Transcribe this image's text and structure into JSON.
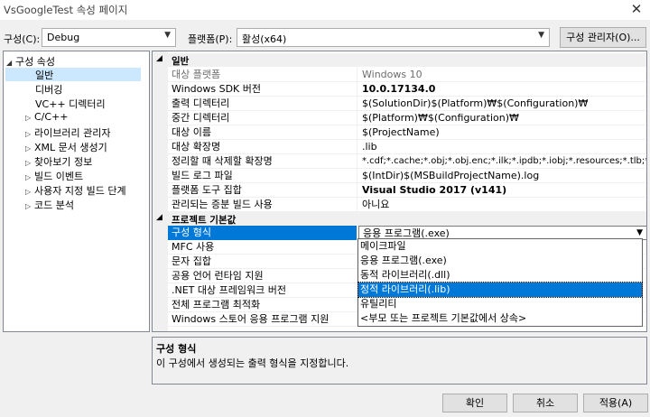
{
  "window": {
    "title": "VsGoogleTest 속성 페이지",
    "close": "✕"
  },
  "toolbar": {
    "config_label": "구성(C):",
    "config_value": "Debug",
    "platform_label": "플랫폼(P):",
    "platform_value": "활성(x64)",
    "config_manager_label": "구성 관리자(O)..."
  },
  "tree": {
    "root": "구성 속성",
    "items": [
      {
        "label": "일반",
        "expanded": false,
        "selected": true,
        "child": true
      },
      {
        "label": "디버깅",
        "child": true
      },
      {
        "label": "VC++ 디렉터리",
        "child": true
      },
      {
        "label": "C/C++",
        "collapsible": true
      },
      {
        "label": "라이브러리 관리자",
        "collapsible": true
      },
      {
        "label": "XML 문서 생성기",
        "collapsible": true
      },
      {
        "label": "찾아보기 정보",
        "collapsible": true
      },
      {
        "label": "빌드 이벤트",
        "collapsible": true
      },
      {
        "label": "사용자 지정 빌드 단계",
        "collapsible": true
      },
      {
        "label": "코드 분석",
        "collapsible": true
      }
    ]
  },
  "grid": {
    "general_header": "일반",
    "general_rows": [
      {
        "name": "대상 플랫폼",
        "value": "Windows 10"
      },
      {
        "name": "Windows SDK 버전",
        "value": "10.0.17134.0"
      },
      {
        "name": "출력 디렉터리",
        "value": "$(SolutionDir)$(Platform)₩$(Configuration)₩"
      },
      {
        "name": "중간 디렉터리",
        "value": "$(Platform)₩$(Configuration)₩"
      },
      {
        "name": "대상 이름",
        "value": "$(ProjectName)"
      },
      {
        "name": "대상 확장명",
        "value": ".lib"
      },
      {
        "name": "정리할 때 삭제할 확장명",
        "value": "*.cdf;*.cache;*.obj;*.obj.enc;*.ilk;*.ipdb;*.iobj;*.resources;*.tlb;*.tli;*.tlh;*."
      },
      {
        "name": "빌드 로그 파일",
        "value": "$(IntDir)$(MSBuildProjectName).log"
      },
      {
        "name": "플랫폼 도구 집합",
        "value": "Visual Studio 2017 (v141)"
      },
      {
        "name": "관리되는 증분 빌드 사용",
        "value": "아니요"
      }
    ],
    "project_header": "프로젝트 기본값",
    "project_rows": [
      {
        "name": "구성 형식",
        "value": "응용 프로그램(.exe)"
      },
      {
        "name": "MFC 사용",
        "value": ""
      },
      {
        "name": "문자 집합",
        "value": ""
      },
      {
        "name": "공용 언어 런타임 지원",
        "value": ""
      },
      {
        "name": ".NET 대상 프레임워크 버전",
        "value": ""
      },
      {
        "name": "전체 프로그램 최적화",
        "value": ""
      },
      {
        "name": "Windows 스토어 응용 프로그램 지원",
        "value": ""
      }
    ]
  },
  "dropdown": {
    "options": [
      "메이크파일",
      "응용 프로그램(.exe)",
      "동적 라이브러리(.dll)",
      "정적 라이브러리(.lib)",
      "유틸리티",
      "<부모 또는 프로젝트 기본값에서 상속>"
    ],
    "selected_index": 3
  },
  "description": {
    "title": "구성 형식",
    "text": "이 구성에서 생성되는 출력 형식을 지정합니다."
  },
  "buttons": {
    "ok": "확인",
    "cancel": "취소",
    "apply": "적용(A)"
  }
}
